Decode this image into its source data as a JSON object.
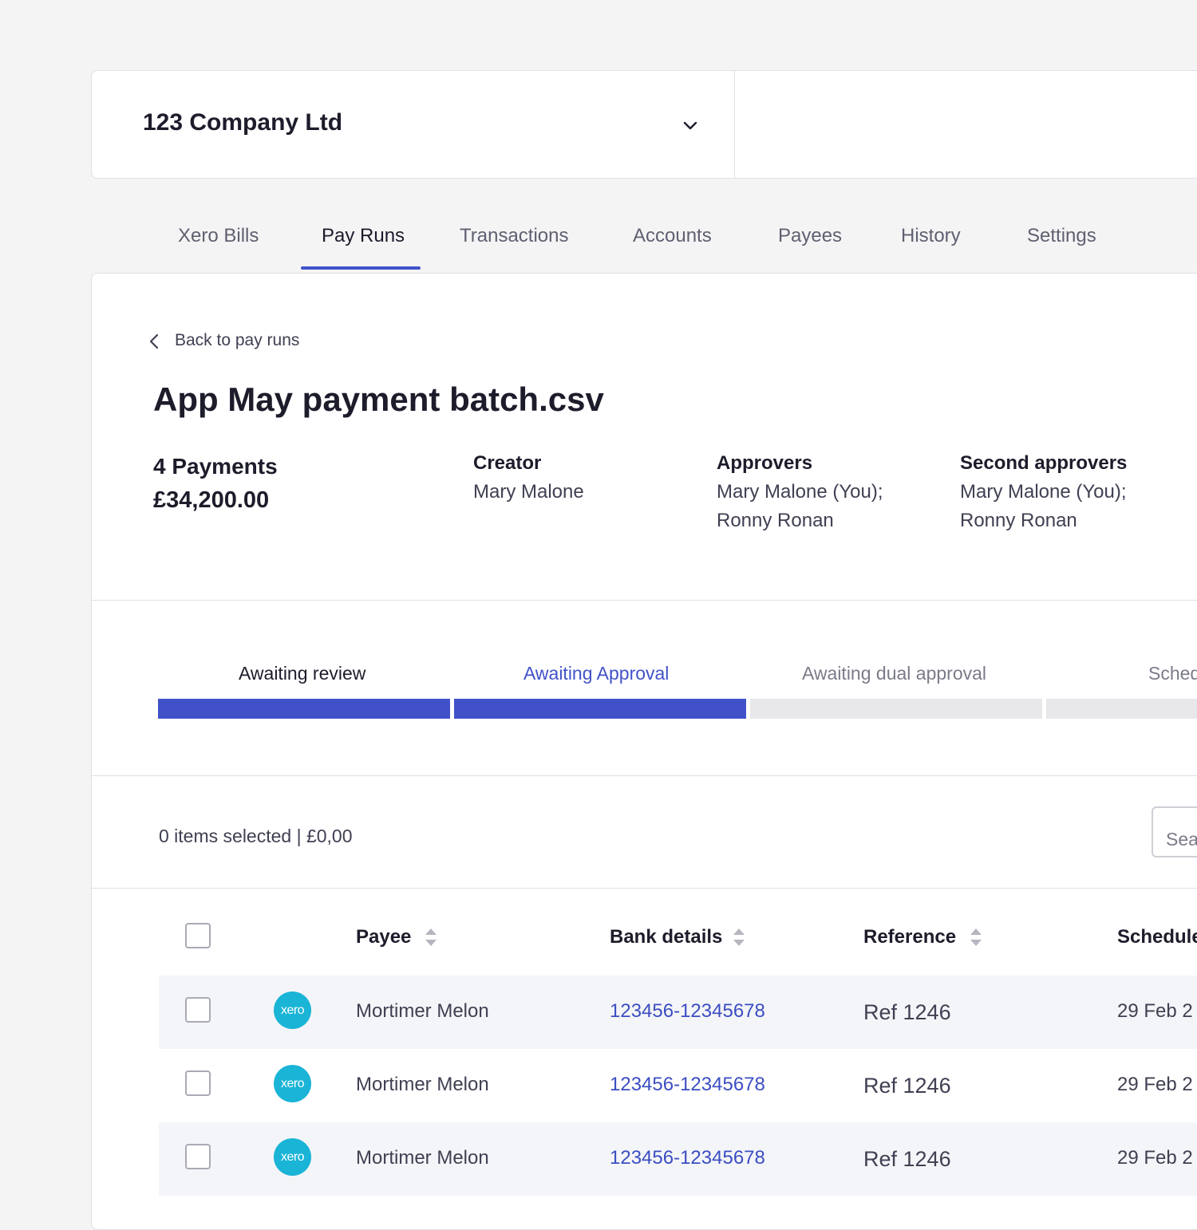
{
  "company": {
    "name": "123 Company Ltd"
  },
  "tabs": [
    {
      "label": "Xero Bills"
    },
    {
      "label": "Pay Runs"
    },
    {
      "label": "Transactions"
    },
    {
      "label": "Accounts"
    },
    {
      "label": "Payees"
    },
    {
      "label": "History"
    },
    {
      "label": "Settings"
    }
  ],
  "active_tab": "Pay Runs",
  "back_link": "Back to pay runs",
  "title": "App May payment batch.csv",
  "summary": {
    "count": "4 Payments",
    "total": "£34,200.00"
  },
  "meta": {
    "creator": {
      "heading": "Creator",
      "lines": [
        "Mary Malone"
      ]
    },
    "approvers": {
      "heading": "Approvers",
      "lines": [
        "Mary Malone (You);",
        "Ronny Ronan"
      ]
    },
    "second_approvers": {
      "heading": "Second approvers",
      "lines": [
        "Mary Malone (You);",
        "Ronny Ronan"
      ]
    }
  },
  "steps": [
    {
      "label": "Awaiting review",
      "complete": true
    },
    {
      "label": "Awaiting Approval",
      "complete": true
    },
    {
      "label": "Awaiting dual approval",
      "complete": false
    },
    {
      "label": "Sched",
      "complete": false
    }
  ],
  "selection": {
    "text": "0 items selected | £0,00"
  },
  "search": {
    "placeholder": "Sea"
  },
  "table": {
    "columns": [
      "Payee",
      "Bank details",
      "Reference",
      "Schedule"
    ],
    "rows": [
      {
        "logo": "xero",
        "payee": "Mortimer Melon",
        "bank": "123456-12345678",
        "reference": "Ref 1246",
        "schedule": "29 Feb 2"
      },
      {
        "logo": "xero",
        "payee": "Mortimer Melon",
        "bank": "123456-12345678",
        "reference": "Ref 1246",
        "schedule": "29 Feb 2"
      },
      {
        "logo": "xero",
        "payee": "Mortimer Melon",
        "bank": "123456-12345678",
        "reference": "Ref 1246",
        "schedule": "29 Feb 2"
      }
    ]
  },
  "colors": {
    "accent": "#4152c9",
    "link": "#3b4dc2",
    "logo": "#1ab4d7",
    "inactive_step": "#e8e8ea"
  }
}
